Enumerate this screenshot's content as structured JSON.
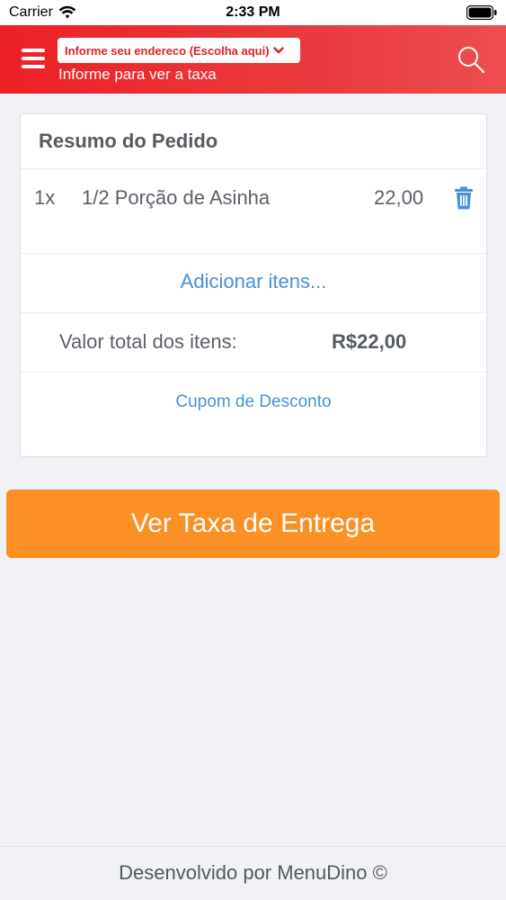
{
  "status_bar": {
    "carrier": "Carrier",
    "time": "2:33 PM",
    "wifi_icon": "wifi-icon",
    "battery_icon": "battery-icon"
  },
  "header": {
    "menu_icon": "hamburger-menu-icon",
    "address_select": "Informe seu endereco (Escolha aqui)",
    "address_hint": "Informe para ver a taxa",
    "search_icon": "search-icon",
    "background_color": "#ec2027"
  },
  "order_summary": {
    "title": "Resumo do Pedido",
    "items": [
      {
        "qty": "1x",
        "name": "1/2 Porção de Asinha",
        "price": "22,00",
        "icon": "trash-icon"
      }
    ],
    "add_items_label": "Adicionar itens...",
    "total_label": "Valor total dos itens:",
    "total_value": "R$22,00",
    "coupon_label": "Cupom de Desconto",
    "link_color": "#4a90d9"
  },
  "cta": {
    "label": "Ver Taxa de Entrega",
    "color": "#fb9126"
  },
  "footer": {
    "text": "Desenvolvido por MenuDino ©"
  }
}
